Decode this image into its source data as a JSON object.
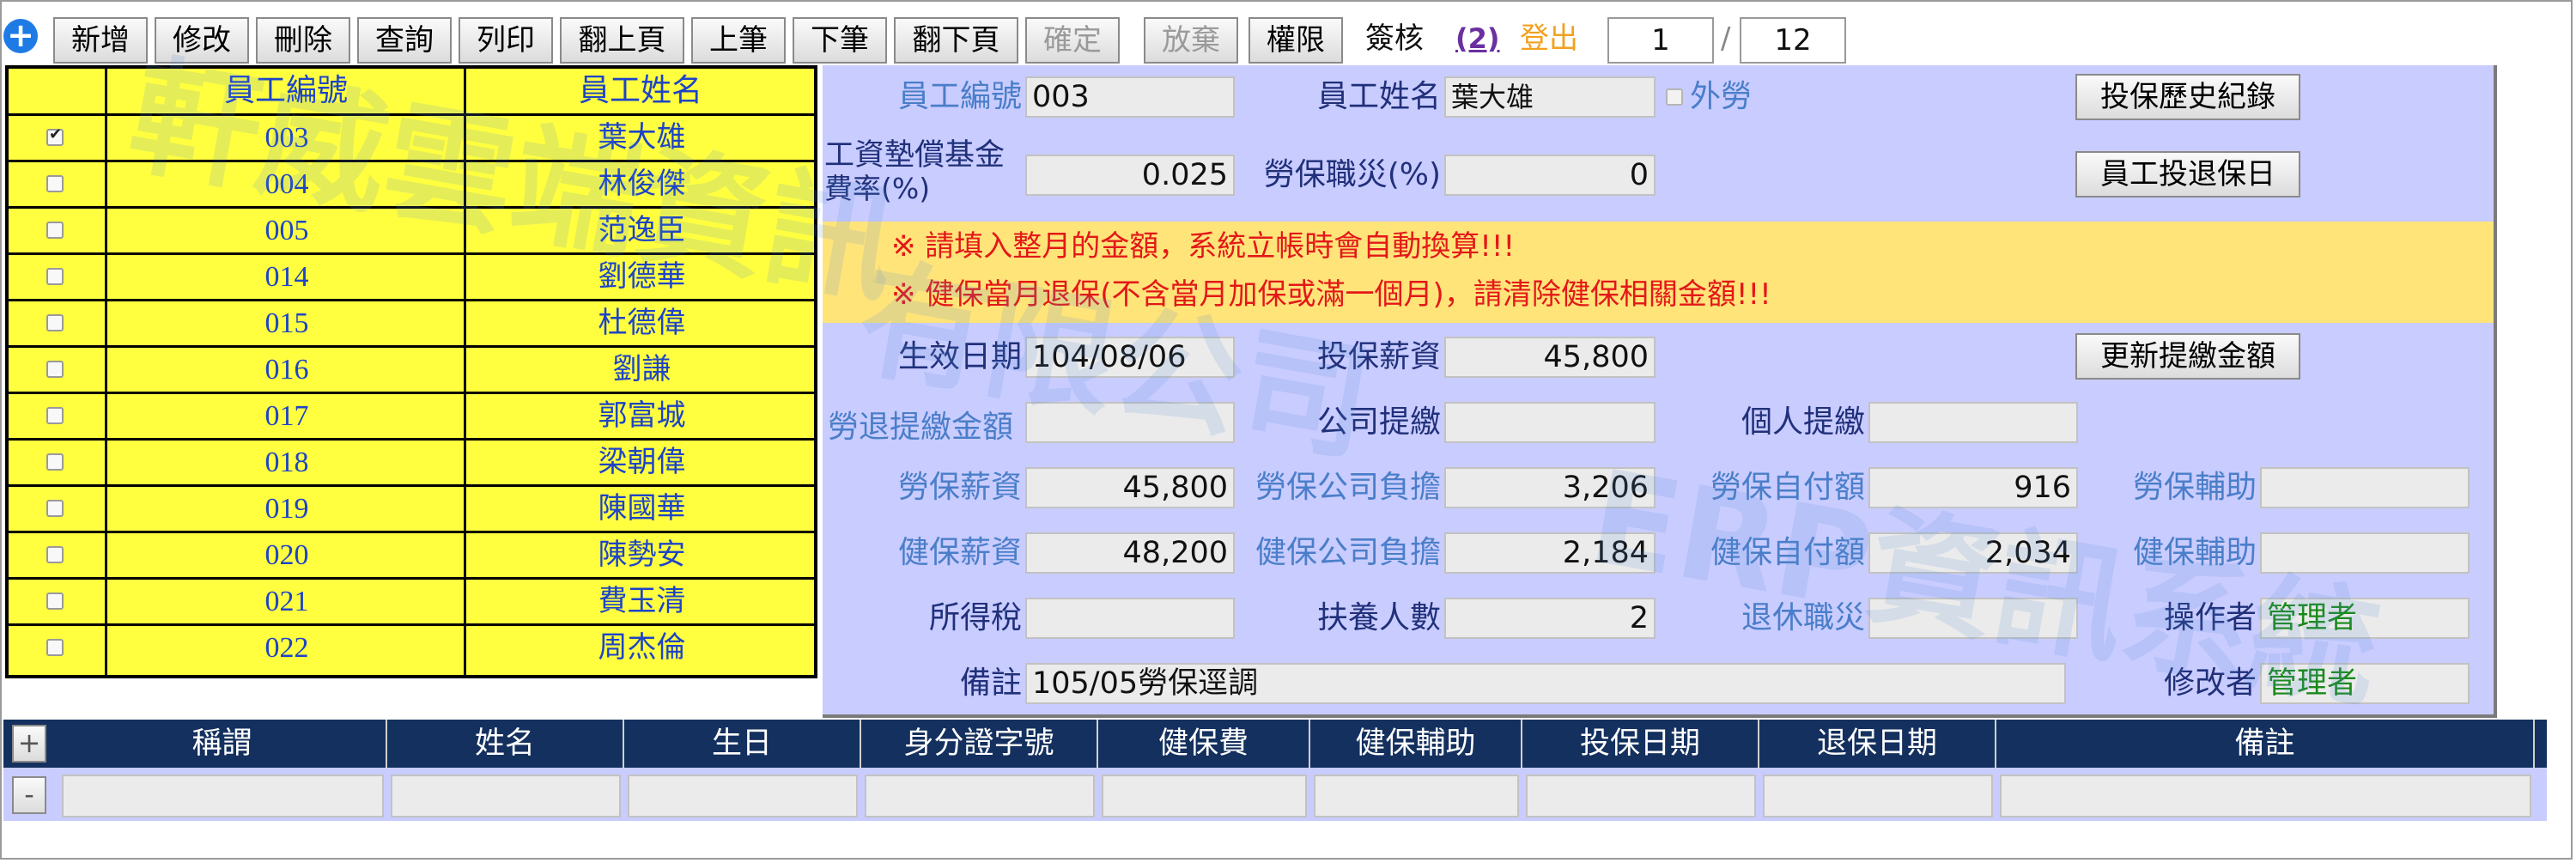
{
  "toolbar": {
    "buttons": [
      {
        "label": "新增",
        "enabled": true
      },
      {
        "label": "修改",
        "enabled": true
      },
      {
        "label": "刪除",
        "enabled": true
      },
      {
        "label": "查詢",
        "enabled": true
      },
      {
        "label": "列印",
        "enabled": true
      },
      {
        "label": "翻上頁",
        "enabled": true
      },
      {
        "label": "上筆",
        "enabled": true
      },
      {
        "label": "下筆",
        "enabled": true
      },
      {
        "label": "翻下頁",
        "enabled": true
      },
      {
        "label": "確定",
        "enabled": false
      },
      {
        "label": "放棄",
        "enabled": false
      },
      {
        "label": "權限",
        "enabled": true
      }
    ],
    "sign_label": "簽核",
    "sign_count": "(2)",
    "logout_label": "登出",
    "current_page": "1",
    "page_separator": "/",
    "total_pages": "12"
  },
  "employee_list": {
    "header_id": "員工編號",
    "header_name": "員工姓名",
    "rows": [
      {
        "id": "003",
        "name": "葉大雄",
        "checked": true
      },
      {
        "id": "004",
        "name": "林俊傑",
        "checked": false
      },
      {
        "id": "005",
        "name": "范逸臣",
        "checked": false
      },
      {
        "id": "014",
        "name": "劉德華",
        "checked": false
      },
      {
        "id": "015",
        "name": "杜德偉",
        "checked": false
      },
      {
        "id": "016",
        "name": "劉謙",
        "checked": false
      },
      {
        "id": "017",
        "name": "郭富城",
        "checked": false
      },
      {
        "id": "018",
        "name": "梁朝偉",
        "checked": false
      },
      {
        "id": "019",
        "name": "陳國華",
        "checked": false
      },
      {
        "id": "020",
        "name": "陳勢安",
        "checked": false
      },
      {
        "id": "021",
        "name": "費玉清",
        "checked": false
      },
      {
        "id": "022",
        "name": "周杰倫",
        "checked": false
      }
    ]
  },
  "watermark": {
    "line1": "軒威雲端資訊",
    "line2": "有限公司",
    "line3": "ERP資訊系統"
  },
  "detail": {
    "emp_id_label": "員工編號",
    "emp_id": "003",
    "emp_name_label": "員工姓名",
    "emp_name": "葉大雄",
    "foreign_label": "外勞",
    "history_button": "投保歷史紀錄",
    "wage_fund_label_1": "工資墊償基金",
    "wage_fund_label_2": "費率(%)",
    "wage_fund_rate": "0.025",
    "occ_injury_label": "勞保職災(%)",
    "occ_injury_rate": "0",
    "enroll_date_button": "員工投退保日",
    "notice_1": "※ 請填入整月的金額，系統立帳時會自動換算!!!",
    "notice_2": "※ 健保當月退保(不含當月加保或滿一個月)，請清除健保相關金額!!!",
    "effective_date_label": "生效日期",
    "effective_date": "104/08/06",
    "insured_salary_label": "投保薪資",
    "insured_salary": "45,800",
    "update_button": "更新提繳金額",
    "pension_label": "勞退提繳金額",
    "pension_amount": "",
    "company_contrib_label": "公司提繳",
    "company_contrib": "",
    "personal_contrib_label": "個人提繳",
    "personal_contrib": "",
    "labor_salary_label": "勞保薪資",
    "labor_salary": "45,800",
    "labor_company_label": "勞保公司負擔",
    "labor_company": "3,206",
    "labor_self_label": "勞保自付額",
    "labor_self": "916",
    "labor_subsidy_label": "勞保輔助",
    "labor_subsidy": "",
    "health_salary_label": "健保薪資",
    "health_salary": "48,200",
    "health_company_label": "健保公司負擔",
    "health_company": "2,184",
    "health_self_label": "健保自付額",
    "health_self": "2,034",
    "health_subsidy_label": "健保輔助",
    "health_subsidy": "",
    "income_tax_label": "所得稅",
    "income_tax": "",
    "dependents_label": "扶養人數",
    "dependents": "2",
    "retirement_label": "退休職災",
    "retirement": "",
    "operator_label": "操作者",
    "operator": "管理者",
    "remark_label": "備註",
    "remark": "105/05勞保逕調",
    "modifier_label": "修改者",
    "modifier": "管理者"
  },
  "dependents_grid": {
    "add_label": "+",
    "remove_label": "-",
    "columns": [
      "稱謂",
      "姓名",
      "生日",
      "身分證字號",
      "健保費",
      "健保輔助",
      "投保日期",
      "退保日期",
      "備註"
    ]
  },
  "colors": {
    "list_bg": "#ffff40",
    "form_bg": "#c9ccff",
    "notice_bg": "#ffe47a",
    "notice_text": "#e31818",
    "grid_header": "#14305e",
    "accent_blue": "#1d44c7"
  }
}
